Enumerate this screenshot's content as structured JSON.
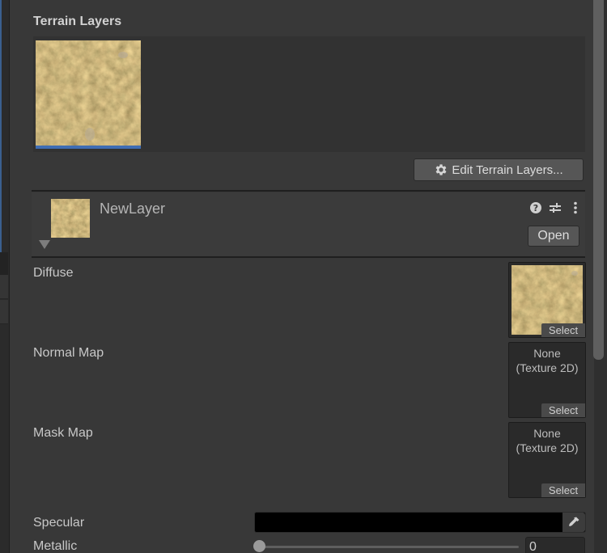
{
  "section": {
    "title": "Terrain Layers",
    "edit_button_label": "Edit Terrain Layers...",
    "selected_indicator_color": "#3f6db4"
  },
  "terrain_layers": [
    {
      "name": "NewLayer",
      "selected": true
    }
  ],
  "layer_editor": {
    "name": "NewLayer",
    "open_label": "Open",
    "header_icons": [
      "help-icon",
      "presets-icon",
      "more-options-icon"
    ]
  },
  "properties": {
    "diffuse": {
      "label": "Diffuse",
      "select_label": "Select",
      "assigned": true
    },
    "normal_map": {
      "label": "Normal Map",
      "value_line1": "None",
      "value_line2": "(Texture 2D)",
      "select_label": "Select"
    },
    "mask_map": {
      "label": "Mask Map",
      "value_line1": "None",
      "value_line2": "(Texture 2D)",
      "select_label": "Select"
    },
    "specular": {
      "label": "Specular",
      "color": "#000000"
    },
    "metallic": {
      "label": "Metallic",
      "value": "0",
      "slider_fraction": 0
    }
  }
}
